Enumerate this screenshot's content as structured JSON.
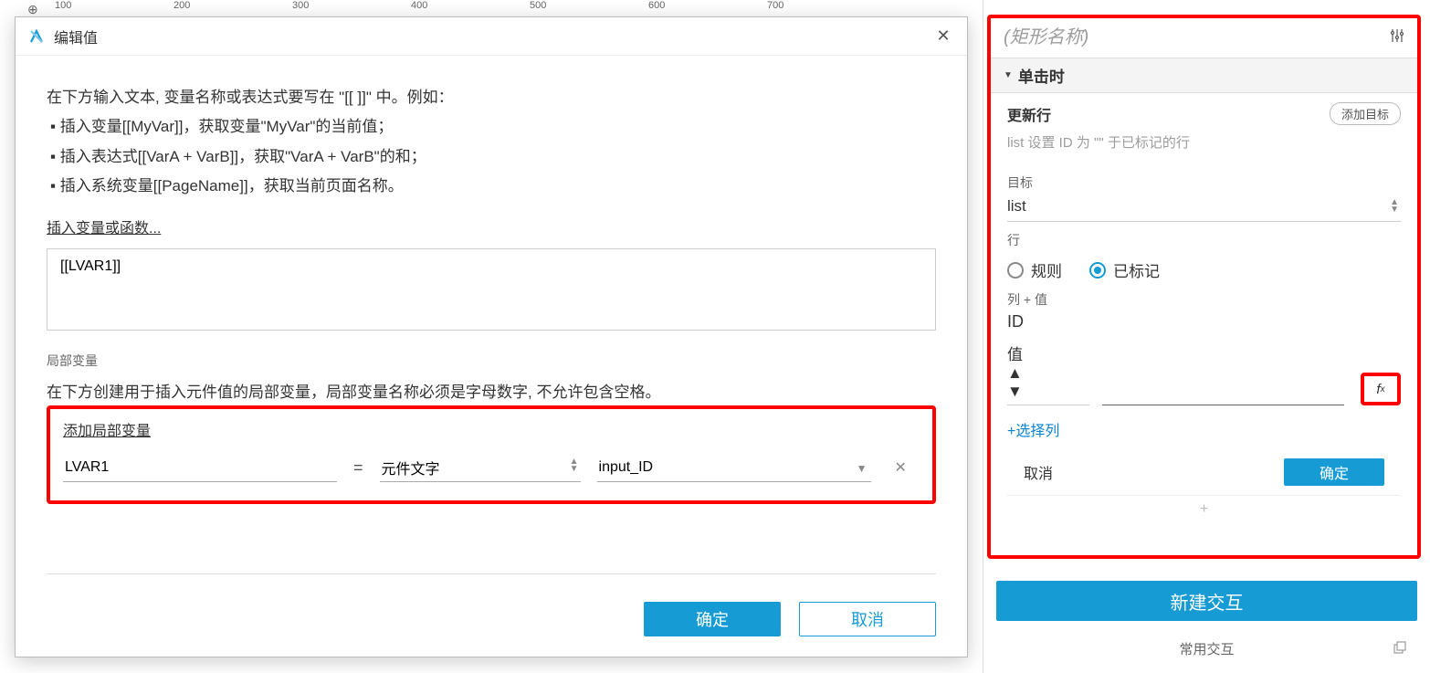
{
  "ruler_marks": [
    "100",
    "200",
    "300",
    "400",
    "500",
    "600",
    "700"
  ],
  "dialog": {
    "title": "编辑值",
    "intro_main": "在下方输入文本, 变量名称或表达式要写在 \"[[ ]]\" 中。例如：",
    "intro_b1": "▪ 插入变量[[MyVar]]，获取变量\"MyVar\"的当前值；",
    "intro_b2": "▪ 插入表达式[[VarA + VarB]]，获取\"VarA + VarB\"的和；",
    "intro_b3": "▪ 插入系统变量[[PageName]]，获取当前页面名称。",
    "insert_link": "插入变量或函数...",
    "expression": "[[LVAR1]]",
    "local_var_label": "局部变量",
    "local_var_desc": "在下方创建用于插入元件值的局部变量，局部变量名称必须是字母数字, 不允许包含空格。",
    "add_var_link": "添加局部变量",
    "var_name": "LVAR1",
    "var_source": "元件文字",
    "var_target": "input_ID",
    "ok": "确定",
    "cancel": "取消"
  },
  "panel": {
    "name_placeholder": "(矩形名称)",
    "event": "单击时",
    "case_title": "更新行",
    "add_target": "添加目标",
    "case_desc": "list 设置 ID 为 \"\" 于已标记的行",
    "target_label": "目标",
    "target_value": "list",
    "row_label": "行",
    "radio_rule": "规则",
    "radio_marked": "已标记",
    "colval_label": "列 + 值",
    "col_id": "ID",
    "col_val_label": "值",
    "fx_label": "fₓ",
    "add_col": "+选择列",
    "cancel": "取消",
    "ok": "确定",
    "new_interaction": "新建交互",
    "common": "常用交互"
  }
}
